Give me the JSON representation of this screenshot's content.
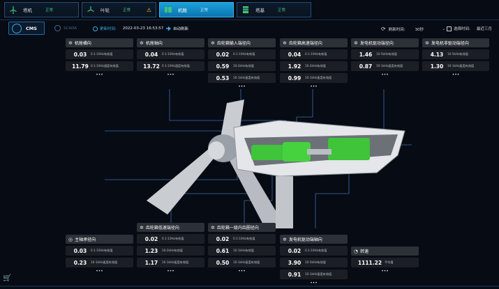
{
  "tabs": [
    {
      "name": "塔机",
      "status": "正常",
      "icon": "wind-turbine-icon",
      "active": false,
      "warning": false
    },
    {
      "name": "叶轮",
      "status": "正常",
      "icon": "rotor-icon",
      "active": false,
      "warning": true
    },
    {
      "name": "机舱",
      "status": "正常",
      "icon": "nacelle-icon",
      "active": true,
      "warning": false
    },
    {
      "name": "塔基",
      "status": "正常",
      "icon": "tower-base-icon",
      "active": false,
      "warning": false
    }
  ],
  "header": {
    "cms_label": "CMS",
    "scada_label": "SCADA",
    "refresh_label": "更新时间:",
    "refresh_value": "2022-03-23 16:53:57",
    "auto_refresh_label": "自动刷新",
    "interval_label": "刷新时间:",
    "interval_value": "30秒",
    "range_label": "选择时间:",
    "range_value": "最近三月"
  },
  "more": "•••",
  "cards": [
    {
      "title": "机舱横向",
      "icon": "gear-icon",
      "rows": [
        {
          "value": "0.03",
          "desc": "0.1-10Hz有效值"
        },
        {
          "value": "11.79",
          "desc": "0.1-10Hz速度有效值"
        }
      ]
    },
    {
      "title": "机舱轴向",
      "icon": "gear-icon",
      "rows": [
        {
          "value": "0.04",
          "desc": "0.1-10Hz有效值"
        },
        {
          "value": "13.72",
          "desc": "0.1-10Hz速度有效值"
        }
      ]
    },
    {
      "title": "齿轮箱输入端径向",
      "icon": "gear-icon",
      "rows": [
        {
          "value": "0.02",
          "desc": "0.1-10Hz有效值"
        },
        {
          "value": "0.59",
          "desc": "10-2kHz有效值"
        },
        {
          "value": "0.53",
          "desc": "10-1kHz速度有效值"
        }
      ]
    },
    {
      "title": "齿轮箱高速端径向",
      "icon": "gear-icon",
      "rows": [
        {
          "value": "0.04",
          "desc": "0.1-10Hz有效值"
        },
        {
          "value": "1.92",
          "desc": "10-2kHz有效值"
        },
        {
          "value": "0.99",
          "desc": "10-1kHz速度有效值"
        }
      ]
    },
    {
      "title": "发电机驱动端径向",
      "icon": "gear-icon",
      "rows": [
        {
          "value": "1.46",
          "desc": "10-5kHz有效值"
        },
        {
          "value": "0.87",
          "desc": "10-1kHz速度有效值"
        }
      ]
    },
    {
      "title": "发电机非驱动端径向",
      "icon": "gear-icon",
      "rows": [
        {
          "value": "4.13",
          "desc": "10-5kHz有效值"
        },
        {
          "value": "1.30",
          "desc": "10-1kHz速度有效值"
        }
      ]
    },
    {
      "title": "主轴承径向",
      "icon": "bearing-icon",
      "rows": [
        {
          "value": "0.03",
          "desc": "0.1-10Hz有效值"
        },
        {
          "value": "0.23",
          "desc": "10-1kHz速度有效值"
        }
      ]
    },
    {
      "title": "齿轮箱低速端径向",
      "icon": "gear-icon",
      "rows": [
        {
          "value": "0.02",
          "desc": "0.1-10Hz有效值"
        },
        {
          "value": "1.23",
          "desc": "10-2kHz有效值"
        },
        {
          "value": "1.17",
          "desc": "10-1kHz速度有效值"
        }
      ]
    },
    {
      "title": "齿轮箱一级内齿圈径向",
      "icon": "gear-icon",
      "rows": [
        {
          "value": "0.02",
          "desc": "0.1-10Hz有效值"
        },
        {
          "value": "0.61",
          "desc": "10-1kHz有效值"
        },
        {
          "value": "0.50",
          "desc": "10-1kHz速度有效值"
        }
      ]
    },
    {
      "title": "发电机驱动端轴向",
      "icon": "gear-icon",
      "rows": [
        {
          "value": "0.02",
          "desc": "0.1-10Hz有效值"
        },
        {
          "value": "3.90",
          "desc": "10-5kHz有效值"
        },
        {
          "value": "0.91",
          "desc": "10-1kHz速度有效值"
        }
      ]
    },
    {
      "title": "转速",
      "icon": "speed-icon",
      "rows": [
        {
          "value": "1111.22",
          "desc": "平均值"
        }
      ]
    }
  ]
}
